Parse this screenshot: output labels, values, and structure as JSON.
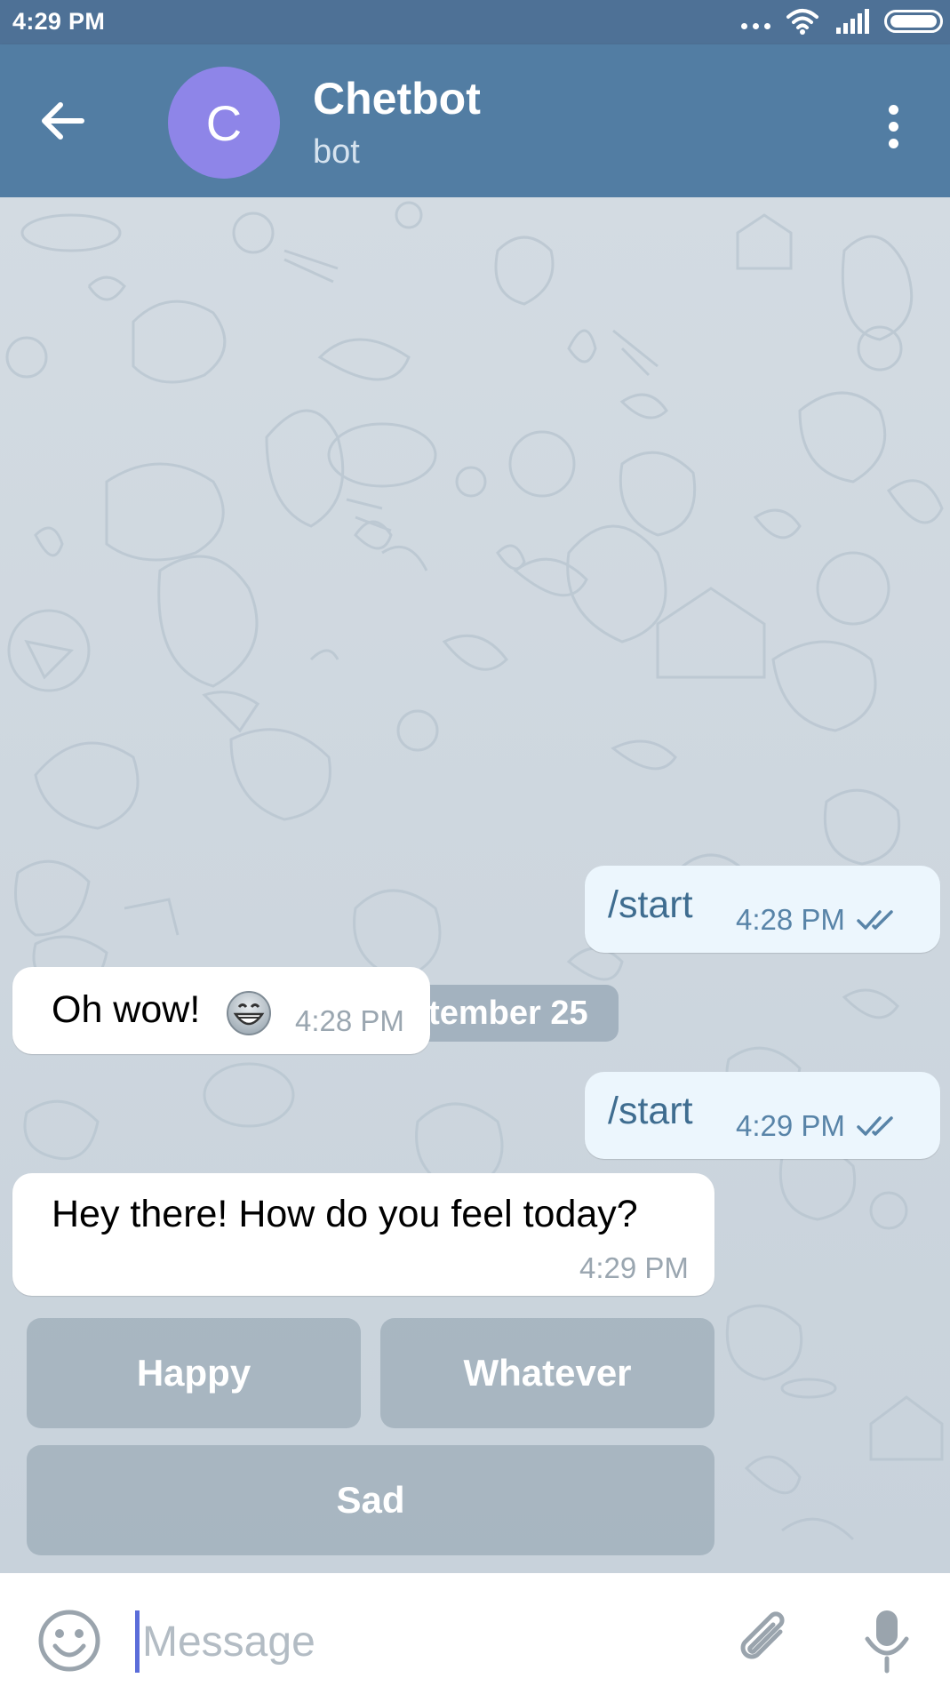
{
  "status_bar": {
    "time": "4:29 PM"
  },
  "chat": {
    "avatar_letter": "C",
    "title": "Chetbot",
    "subtitle": "bot",
    "avatar_color": "#8e85e8"
  },
  "date_separator": "September 25",
  "messages": [
    {
      "direction": "out",
      "text": "/start",
      "time": "4:28 PM",
      "read": true
    },
    {
      "direction": "in",
      "text": "Oh wow!",
      "emoji": "grinning-face",
      "time": "4:28 PM"
    },
    {
      "direction": "out",
      "text": "/start",
      "time": "4:29 PM",
      "read": true
    },
    {
      "direction": "in",
      "text": "Hey there! How do you feel today?",
      "time": "4:29 PM"
    }
  ],
  "keyboard": {
    "buttons": [
      "Happy",
      "Whatever",
      "Sad"
    ]
  },
  "composer": {
    "placeholder": "Message"
  },
  "colors": {
    "header": "#527da3",
    "status_bar": "#4e7196",
    "outgoing_bubble": "#ecf6fd",
    "incoming_bubble": "#ffffff"
  }
}
